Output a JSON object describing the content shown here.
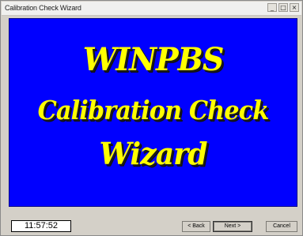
{
  "window": {
    "title": "Calibration Check Wizard",
    "minimize": "_",
    "maximize": "□",
    "close": "×"
  },
  "splash": {
    "line1": "WINPBS",
    "line2": "Calibration Check",
    "line3": "Wizard",
    "background_color": "#0000ff",
    "text_color": "#ffff00"
  },
  "footer": {
    "clock": "11:57:52",
    "back_label": "< Back",
    "next_label": "Next >",
    "cancel_label": "Cancel"
  }
}
